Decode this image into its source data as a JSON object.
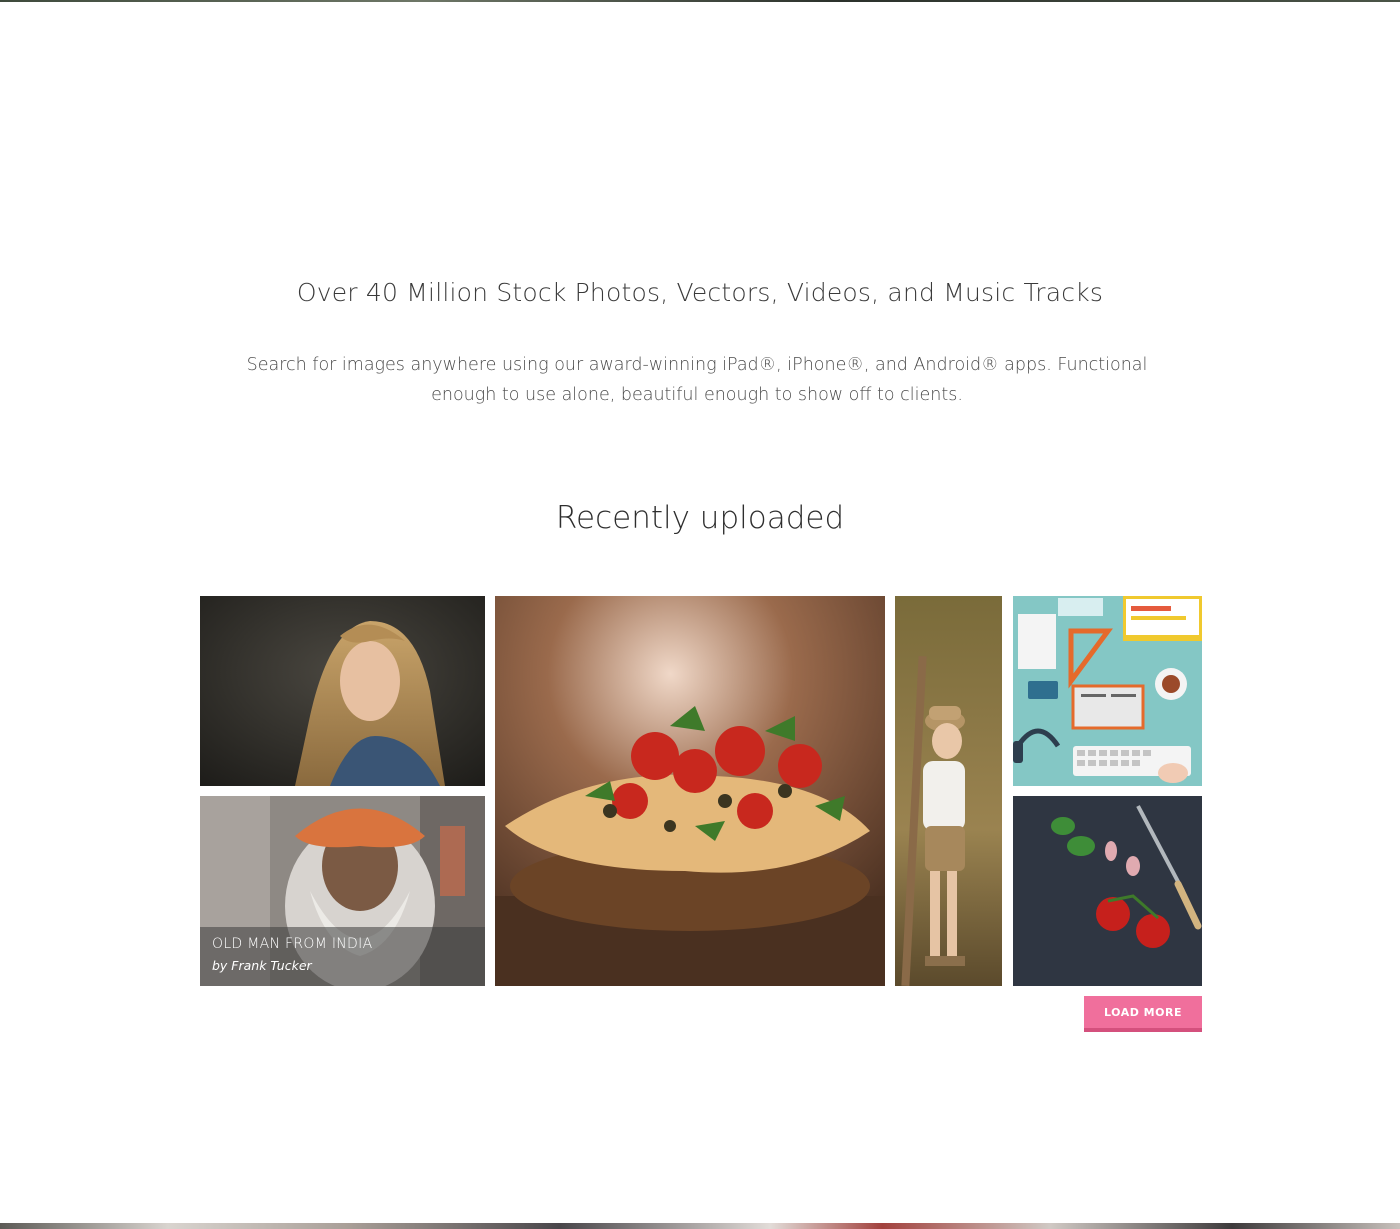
{
  "hero": {
    "headline": "Over 40 Million Stock Photos, Vectors, Videos, and Music Tracks",
    "intro": "Search for images anywhere using our award-winning iPad®, iPhone®, and Android® apps. Functional enough to use alone, beautiful enough to show off to clients."
  },
  "recent": {
    "title": "Recently uploaded",
    "tiles": [
      {
        "kind": "photo-woman"
      },
      {
        "kind": "photo-old-man",
        "caption_title": "OLD MAN FROM INDIA",
        "caption_author": "by Frank Tucker"
      },
      {
        "kind": "photo-pizza"
      },
      {
        "kind": "photo-boy"
      },
      {
        "kind": "illustration-desk"
      },
      {
        "kind": "photo-tomatoes"
      }
    ],
    "load_more_label": "LOAD MORE"
  },
  "colors": {
    "accent": "#f06f9c",
    "accent_dark": "#d4507d",
    "text_dark": "#333333"
  }
}
